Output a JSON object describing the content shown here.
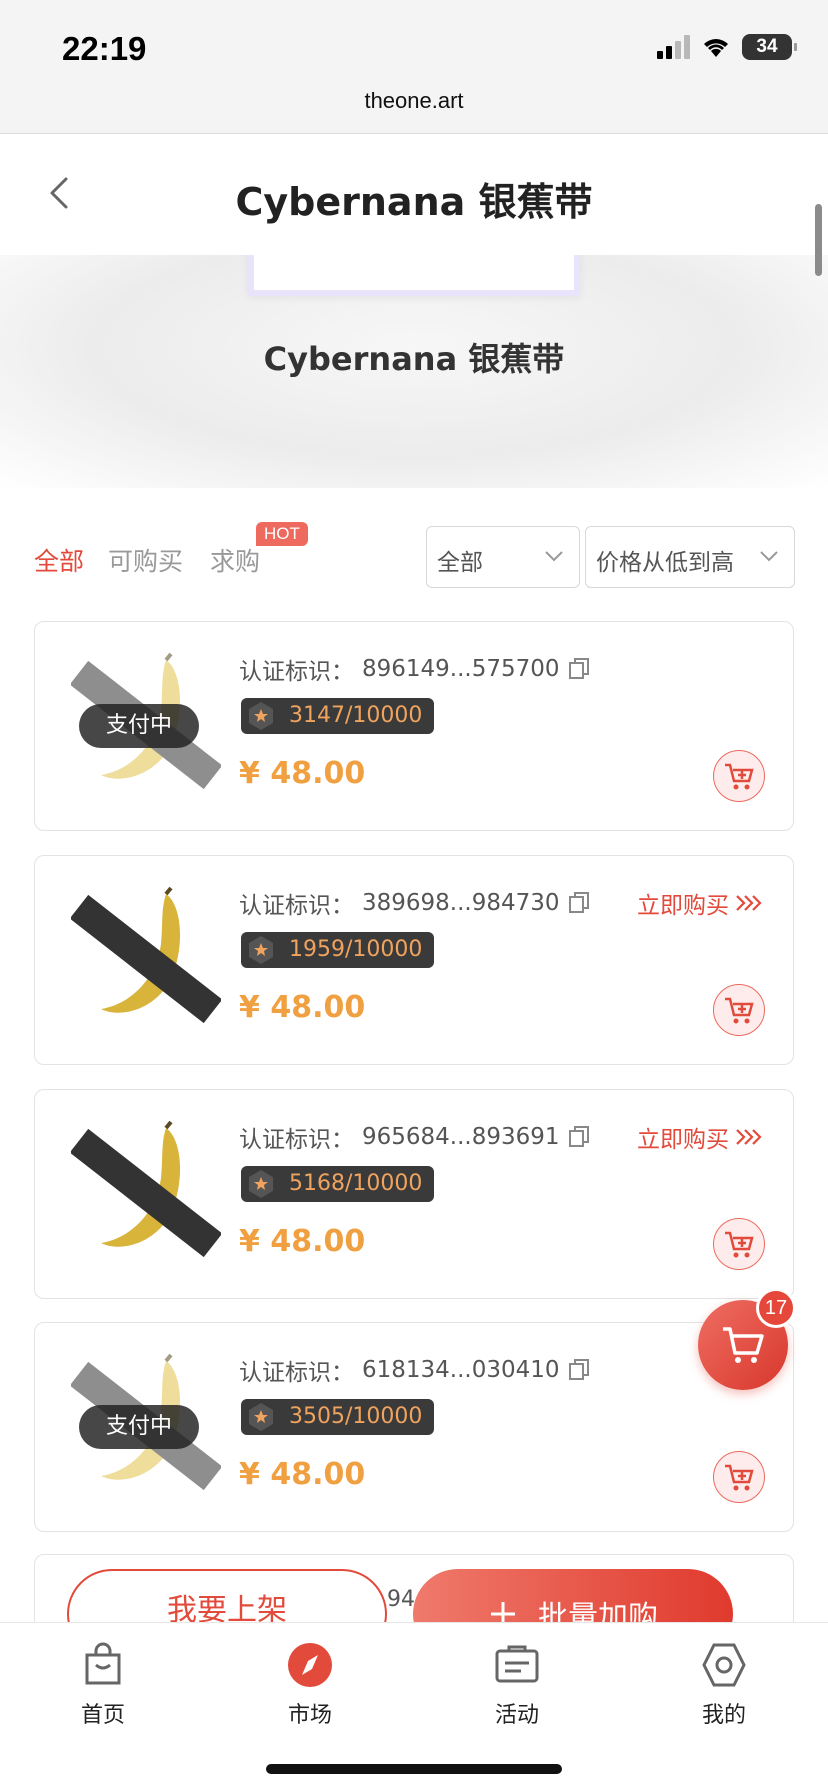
{
  "status_bar": {
    "time": "22:19",
    "battery": "34"
  },
  "browser": {
    "url": "theone.art"
  },
  "header": {
    "title": "Cybernana 银蕉带"
  },
  "hero": {
    "title": "Cybernana 银蕉带"
  },
  "filters": {
    "tabs": [
      {
        "label": "全部",
        "active": true
      },
      {
        "label": "可购买",
        "active": false
      },
      {
        "label": "求购",
        "active": false,
        "badge": "HOT"
      }
    ],
    "dropdown_type": "全部",
    "dropdown_sort": "价格从低到高"
  },
  "listings": [
    {
      "ident_label": "认证标识：",
      "ident": "896149...575700",
      "edition": "3147/10000",
      "price": "¥ 48.00",
      "status": "支付中",
      "buy_now": ""
    },
    {
      "ident_label": "认证标识：",
      "ident": "389698...984730",
      "edition": "1959/10000",
      "price": "¥ 48.00",
      "status": "",
      "buy_now": "立即购买"
    },
    {
      "ident_label": "认证标识：",
      "ident": "965684...893691",
      "edition": "5168/10000",
      "price": "¥ 48.00",
      "status": "",
      "buy_now": "立即购买"
    },
    {
      "ident_label": "认证标识：",
      "ident": "618134...030410",
      "edition": "3505/10000",
      "price": "¥ 48.00",
      "status": "支付中",
      "buy_now": ""
    }
  ],
  "actions": {
    "list_label": "我要上架",
    "bulk_label": "批量加购",
    "partial_number": "94"
  },
  "floating_cart": {
    "count": "17"
  },
  "bottom_nav": [
    {
      "label": "首页",
      "icon": "bag-icon"
    },
    {
      "label": "市场",
      "icon": "compass-icon"
    },
    {
      "label": "活动",
      "icon": "inbox-icon"
    },
    {
      "label": "我的",
      "icon": "hexagon-icon"
    }
  ],
  "colors": {
    "accent": "#e24a3b",
    "price": "#f0a040",
    "edition_text": "#f0a35e"
  }
}
